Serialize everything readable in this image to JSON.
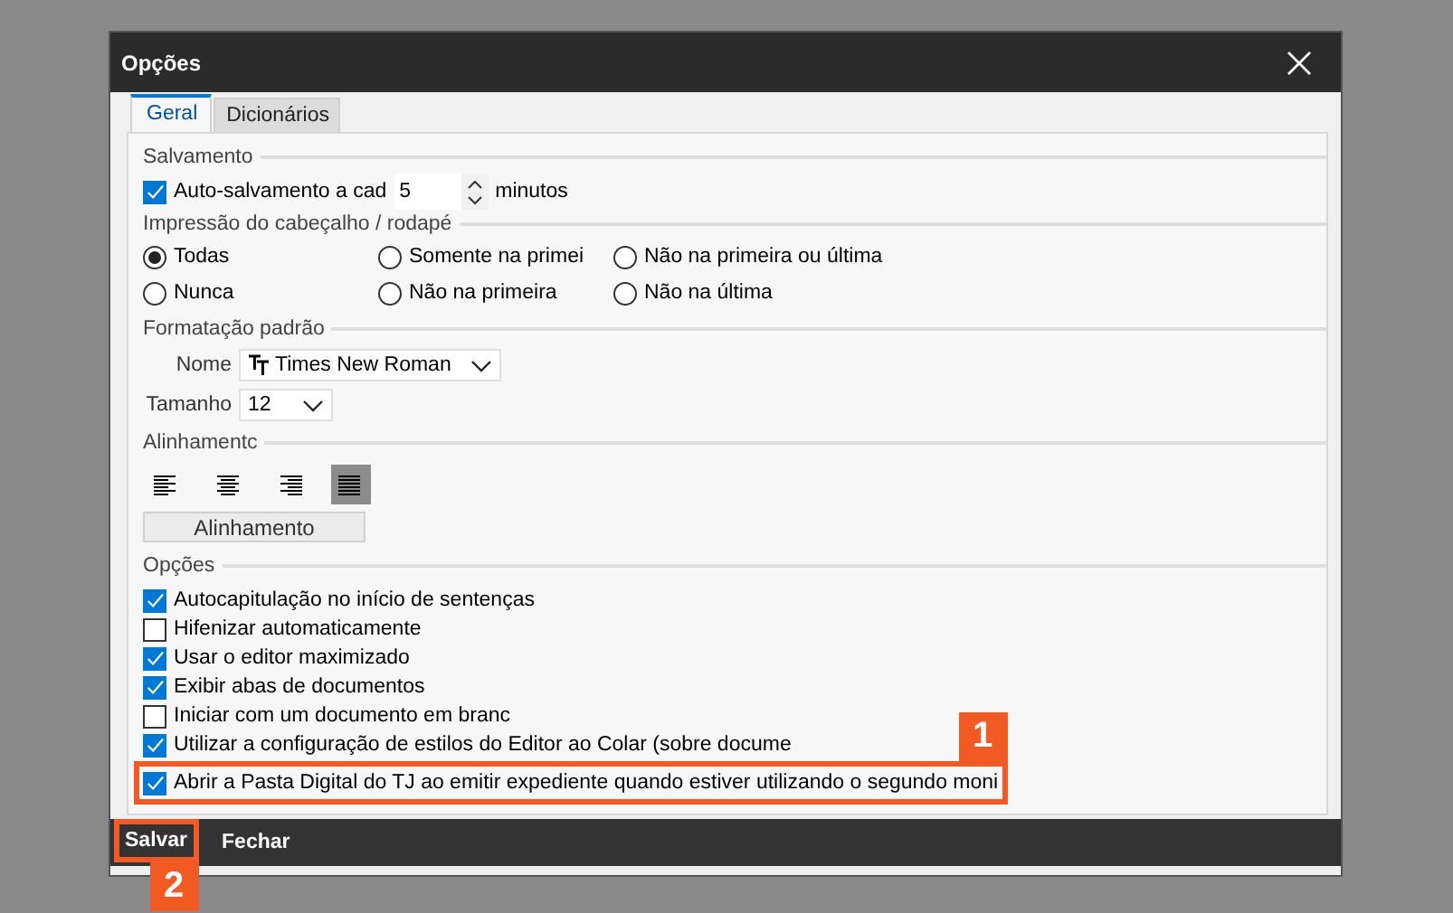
{
  "window": {
    "title": "Opções"
  },
  "tabs": [
    {
      "label": "Geral",
      "selected": true
    },
    {
      "label": "Dicionários",
      "selected": false
    }
  ],
  "salvamento": {
    "title": "Salvamento",
    "autosave": {
      "label": "Auto-salvamento a cad",
      "checked": true,
      "value": "5",
      "unit": "minutos"
    }
  },
  "impressao": {
    "title": "Impressão do cabeçalho / rodapé",
    "options": [
      {
        "label": "Todas",
        "selected": true
      },
      {
        "label": "Somente na primei",
        "selected": false
      },
      {
        "label": "Não na primeira ou última",
        "selected": false
      },
      {
        "label": "Nunca",
        "selected": false
      },
      {
        "label": "Não na primeira",
        "selected": false
      },
      {
        "label": "Não na última",
        "selected": false
      }
    ]
  },
  "formatacao": {
    "title": "Formatação padrão",
    "fields": [
      {
        "label": "Nome",
        "value": "Times New Roman",
        "kind": "font"
      },
      {
        "label": "Tamanho",
        "value": "12",
        "kind": "plain"
      }
    ]
  },
  "alinhamento": {
    "title": "Alinhamentc",
    "buttons": [
      {
        "kind": "left",
        "selected": false
      },
      {
        "kind": "center",
        "selected": false
      },
      {
        "kind": "right",
        "selected": false
      },
      {
        "kind": "justify",
        "selected": true
      }
    ],
    "button_label": "Alinhamento"
  },
  "opcoes": {
    "title": "Opções",
    "items": [
      {
        "label": "Autocapitulação no início de sentenças",
        "checked": true
      },
      {
        "label": "Hifenizar automaticamente",
        "checked": false
      },
      {
        "label": "Usar o editor maximizado",
        "checked": true
      },
      {
        "label": "Exibir abas de documentos",
        "checked": true
      },
      {
        "label": "Iniciar com um documento em branc",
        "checked": false
      },
      {
        "label": "Utilizar a configuração de estilos do Editor ao Colar (sobre docume",
        "checked": true
      },
      {
        "label": "Abrir a Pasta Digital do TJ ao emitir expediente quando estiver utilizando o segundo moni",
        "checked": true,
        "callout": "1"
      }
    ]
  },
  "buttons": [
    {
      "label": "Salvar",
      "callout": "2"
    },
    {
      "label": "Fechar"
    }
  ]
}
